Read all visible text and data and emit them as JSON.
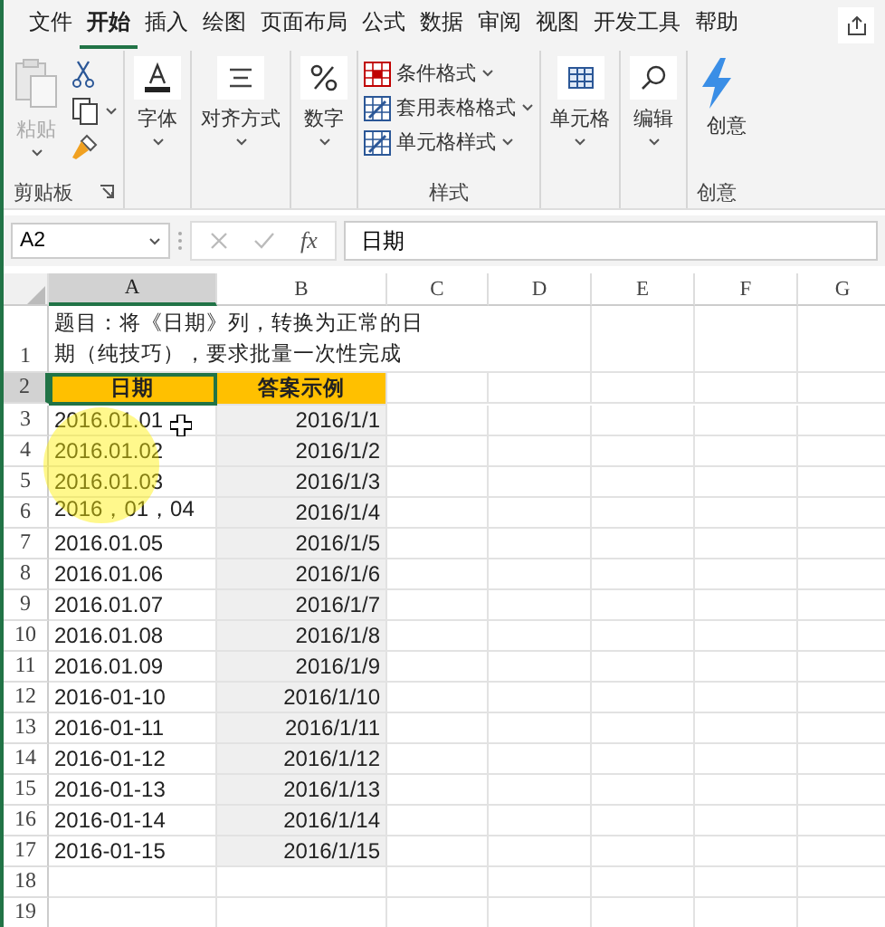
{
  "menu_tabs": [
    {
      "label": "文件",
      "selected": false
    },
    {
      "label": "开始",
      "selected": true
    },
    {
      "label": "插入",
      "selected": false
    },
    {
      "label": "绘图",
      "selected": false
    },
    {
      "label": "页面布局",
      "selected": false
    },
    {
      "label": "公式",
      "selected": false
    },
    {
      "label": "数据",
      "selected": false
    },
    {
      "label": "审阅",
      "selected": false
    },
    {
      "label": "视图",
      "selected": false
    },
    {
      "label": "开发工具",
      "selected": false
    },
    {
      "label": "帮助",
      "selected": false
    }
  ],
  "ribbon_groups": [
    {
      "kind": "clipboard",
      "paste_label": "粘贴",
      "paste_disabled": true,
      "label": "剪贴板"
    },
    {
      "kind": "font",
      "button_label": "字体"
    },
    {
      "kind": "alignment",
      "button_label": "对齐方式"
    },
    {
      "kind": "number",
      "button_label": "数字"
    },
    {
      "kind": "styles",
      "items": [
        {
          "label": "条件格式"
        },
        {
          "label": "套用表格格式"
        },
        {
          "label": "单元格样式"
        }
      ],
      "label": "样式"
    },
    {
      "kind": "cells",
      "button_label": "单元格"
    },
    {
      "kind": "editing",
      "button_label": "编辑"
    },
    {
      "kind": "ideas",
      "button_label": "创意",
      "label": "创意"
    }
  ],
  "formula_bar": {
    "name_box": "A2",
    "function_button": "fx",
    "formula": "日期"
  },
  "sheet": {
    "columns": [
      {
        "label": "A",
        "selected": true
      },
      {
        "label": "B",
        "selected": false
      },
      {
        "label": "C",
        "selected": false
      },
      {
        "label": "D",
        "selected": false
      },
      {
        "label": "E",
        "selected": false
      },
      {
        "label": "F",
        "selected": false
      },
      {
        "label": "G",
        "selected": false
      }
    ],
    "title_row": {
      "number": "1",
      "text": "题目：将《日期》列，转换为正常的日期（纯技巧），要求批量一次性完成"
    },
    "header_row": {
      "number": "2",
      "selected": true,
      "cells": [
        {
          "text": "日期",
          "selected": true
        },
        {
          "text": "答案示例",
          "selected": false
        }
      ]
    },
    "data_rows": [
      {
        "number": "3",
        "date": "2016.01.01",
        "answer": "2016/1/1"
      },
      {
        "number": "4",
        "date": "2016.01.02",
        "answer": "2016/1/2"
      },
      {
        "number": "5",
        "date": "2016.01.03",
        "answer": "2016/1/3"
      },
      {
        "number": "6",
        "date": "2016，01，04",
        "answer": "2016/1/4"
      },
      {
        "number": "7",
        "date": "2016.01.05",
        "answer": "2016/1/5"
      },
      {
        "number": "8",
        "date": "2016.01.06",
        "answer": "2016/1/6"
      },
      {
        "number": "9",
        "date": "2016.01.07",
        "answer": "2016/1/7"
      },
      {
        "number": "10",
        "date": "2016.01.08",
        "answer": "2016/1/8"
      },
      {
        "number": "11",
        "date": "2016.01.09",
        "answer": "2016/1/9"
      },
      {
        "number": "12",
        "date": "2016-01-10",
        "answer": "2016/1/10"
      },
      {
        "number": "13",
        "date": "2016-01-11",
        "answer": "2016/1/11"
      },
      {
        "number": "14",
        "date": "2016-01-12",
        "answer": "2016/1/12"
      },
      {
        "number": "15",
        "date": "2016-01-13",
        "answer": "2016/1/13"
      },
      {
        "number": "16",
        "date": "2016-01-14",
        "answer": "2016/1/14"
      },
      {
        "number": "17",
        "date": "2016-01-15",
        "answer": "2016/1/15"
      }
    ],
    "empty_rows": [
      "18",
      "19"
    ]
  }
}
